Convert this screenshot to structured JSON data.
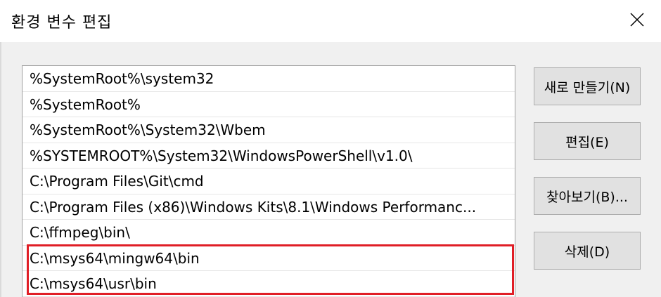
{
  "window": {
    "title": "환경 변수 편집",
    "close_icon": "close-icon"
  },
  "list": {
    "items": [
      "%SystemRoot%\\system32",
      "%SystemRoot%",
      "%SystemRoot%\\System32\\Wbem",
      "%SYSTEMROOT%\\System32\\WindowsPowerShell\\v1.0\\",
      "C:\\Program Files\\Git\\cmd",
      "C:\\Program Files (x86)\\Windows Kits\\8.1\\Windows Performanc...",
      "C:\\ffmpeg\\bin\\",
      "C:\\msys64\\mingw64\\bin",
      "C:\\msys64\\usr\\bin"
    ],
    "highlight_color": "#e01e26"
  },
  "buttons": {
    "new": "새로 만들기(N)",
    "edit": "편집(E)",
    "browse": "찾아보기(B)...",
    "delete": "삭제(D)"
  }
}
